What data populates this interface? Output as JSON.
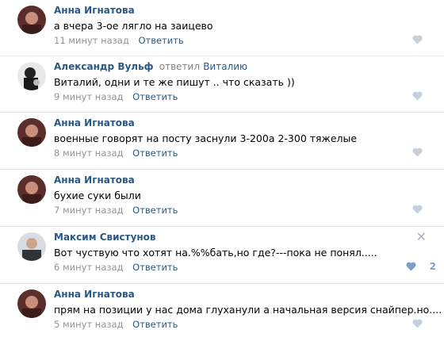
{
  "comments": [
    {
      "author": "Анна Игнатова",
      "text": "а вчера 3-ое лягло на заицево",
      "time": "11 минут назад",
      "reply_label": "Ответить"
    },
    {
      "author": "Александр Вульф",
      "reply_to_prefix": "ответил",
      "reply_to_name": "Виталию",
      "text": "Виталий, одни и те же пишут .. что сказать ))",
      "time": "9 минут назад",
      "reply_label": "Ответить"
    },
    {
      "author": "Анна Игнатова",
      "text": "военные говорят на посту заснули 3-200а 2-300 тяжелые",
      "time": "8 минут назад",
      "reply_label": "Ответить"
    },
    {
      "author": "Анна Игнатова",
      "text": "бухие суки были",
      "time": "7 минут назад",
      "reply_label": "Ответить"
    },
    {
      "author": "Максим Свистунов",
      "text": "Вот чуствую что хотят на.%%бать,но где?---пока не понял.....",
      "time": "6 минут назад",
      "reply_label": "Ответить",
      "likes": "2",
      "close_symbol": "✕"
    },
    {
      "author": "Анна Игнатова",
      "text": "прям на позиции у нас дома глуханули а начальная версия снайпер.но....",
      "time": "5 минут назад",
      "reply_label": "Ответить"
    }
  ],
  "icons": {
    "like": "heart-icon",
    "close": "close-icon"
  },
  "colors": {
    "link": "#2a5885",
    "meta": "#939393",
    "like_inactive": "#c5d0db",
    "like_active": "#7d9fc5"
  }
}
